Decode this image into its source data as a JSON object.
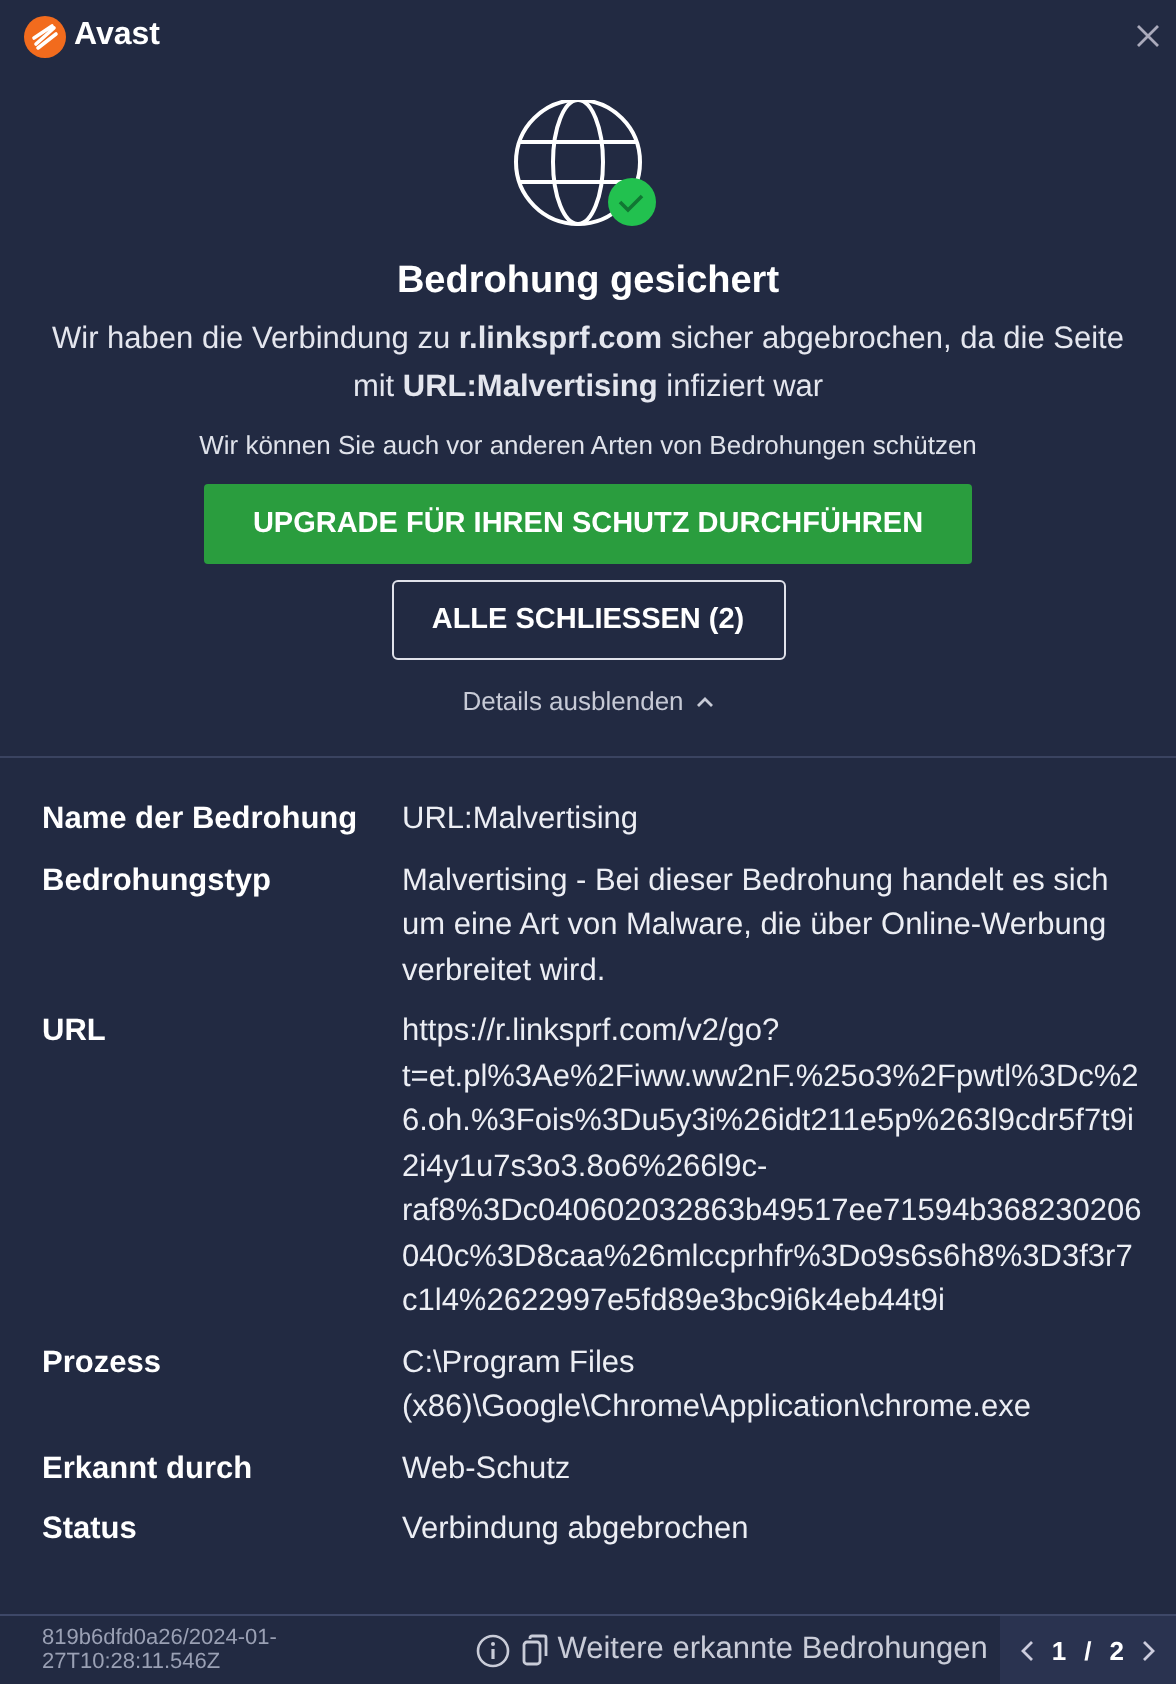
{
  "app": {
    "name": "Avast"
  },
  "alert": {
    "title": "Bedrohung gesichert",
    "message": "Wir haben die Verbindung zu **r.linksprf.com** sicher abgebrochen, da die Seite mit **URL:Malvertising** infiziert war",
    "upsell": "Wir können Sie auch vor anderen Arten von Bedrohungen schützen",
    "primary_button": "UPGRADE FÜR IHREN SCHUTZ DURCHFÜHREN",
    "secondary_button": "ALLE SCHLIESSEN (2)",
    "details_toggle": "Details ausblenden",
    "expanded": true
  },
  "details": [
    {
      "label": "Name der Bedrohung",
      "value": "URL:Malvertising"
    },
    {
      "label": "Bedrohungstyp",
      "value": "Malvertising - Bei dieser Bedrohung handelt es sich um eine Art von Malware, die über Online-Werbung verbreitet wird."
    },
    {
      "label": "URL",
      "value": "https://r.linksprf.com/v2/go?t=et.pl%3Ae%2Fiww.ww2nF.%25o3%2Fpwtl%3Dc%26.oh.%3Fois%3Du5y3i%26idt211e5p%263l9cdr5f7t9i2i4y1u7s3o3.8o6%266l9c-raf8%3Dc040602032863b49517ee71594b368230206040c%3D8caa%26mlccprhfr%3Do9s6s6h8%3D3f3r7c1l4%2622997e5fd89e3bc9i6k4eb44t9i"
    },
    {
      "label": "Prozess",
      "value": "C:\\Program Files (x86)\\Google\\Chrome\\Application\\chrome.exe"
    },
    {
      "label": "Erkannt durch",
      "value": "Web-Schutz"
    },
    {
      "label": "Status",
      "value": "Verbindung abgebrochen"
    }
  ],
  "footer": {
    "id": "819b6dfd0a26/2024-01-27T10:28:11.546Z",
    "more_threats": "Weitere erkannte Bedrohungen",
    "page": "1",
    "separator": "/",
    "total": "2"
  }
}
